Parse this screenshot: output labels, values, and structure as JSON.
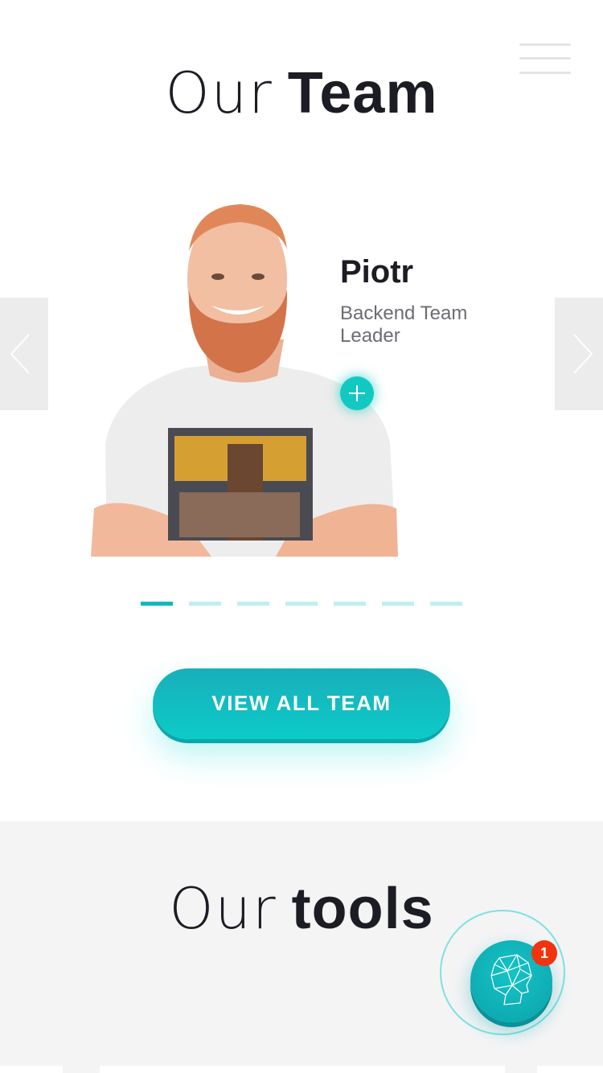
{
  "header": {
    "menu_icon": "hamburger-menu-icon"
  },
  "team": {
    "title_light": "Our",
    "title_bold": "Team",
    "member": {
      "name": "Piotr",
      "role": "Backend Team Leader"
    },
    "slides_total": 7,
    "active_slide": 1,
    "view_all_label": "VIEW ALL TEAM",
    "accent": "#12c9c2"
  },
  "tools": {
    "title_light": "Our",
    "title_bold": "tools"
  },
  "chat": {
    "badge": "1",
    "icon": "robot-head-icon"
  }
}
